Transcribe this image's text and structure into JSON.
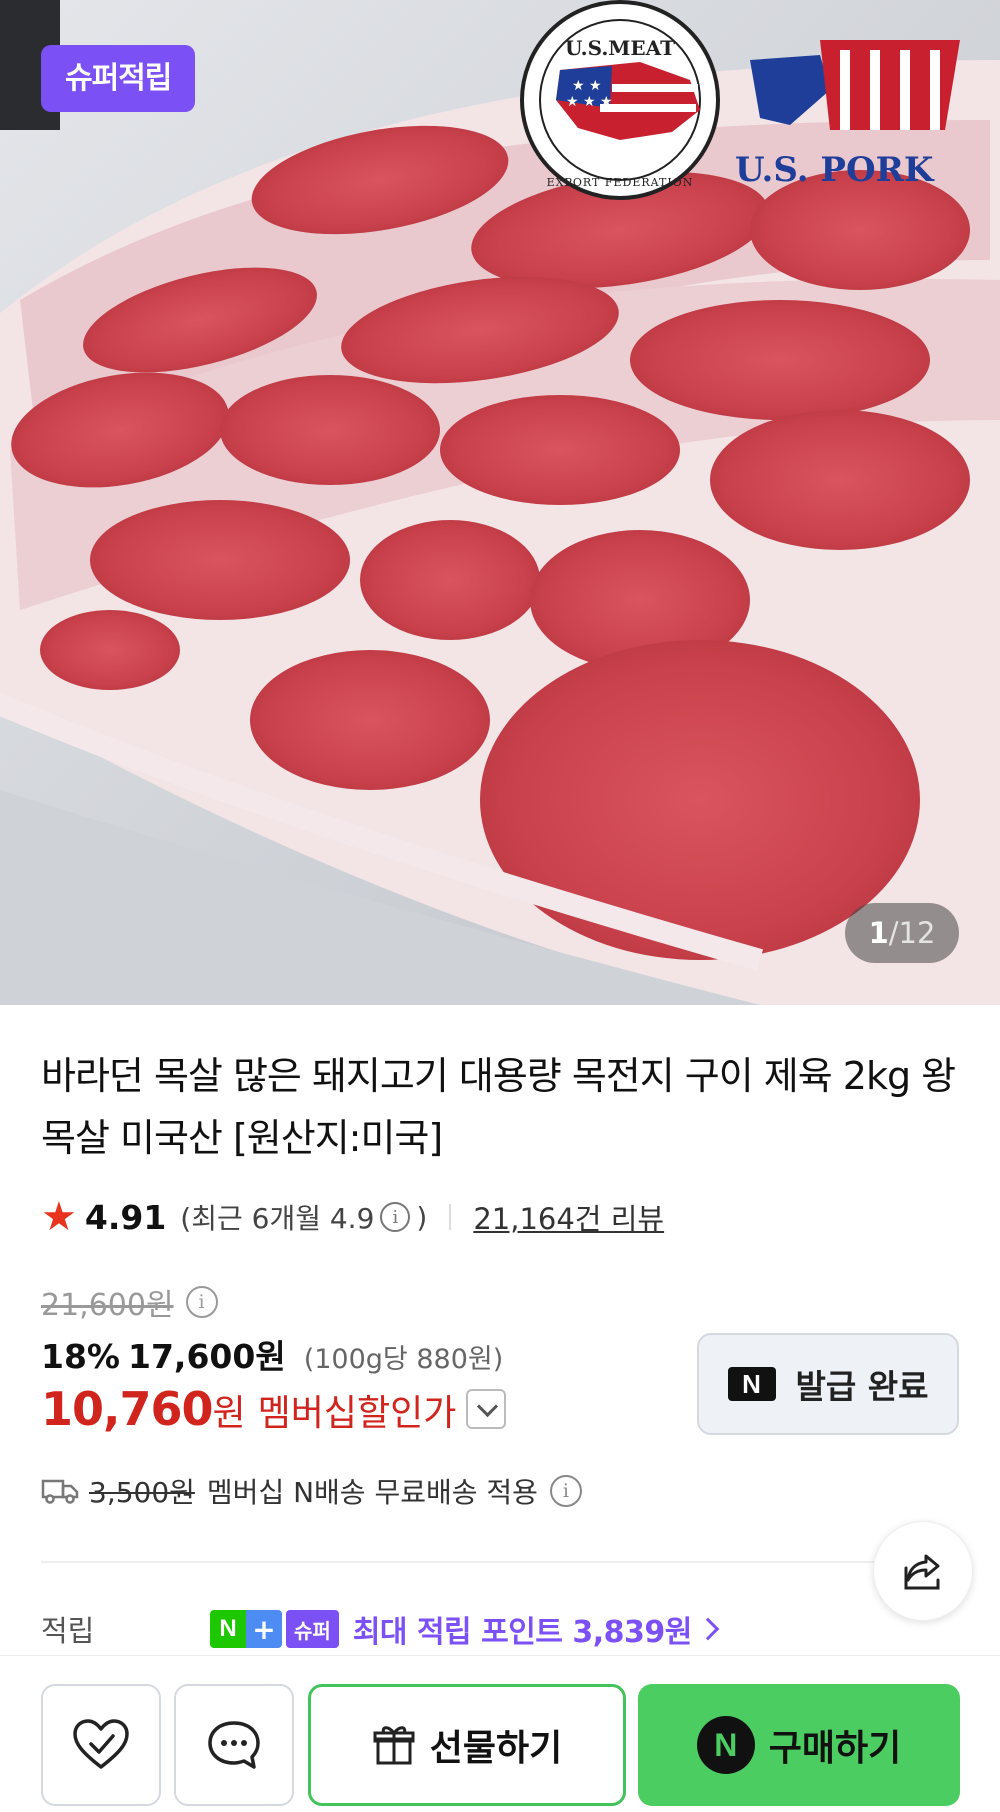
{
  "image": {
    "badge": "슈퍼적립",
    "counter_current": "1",
    "counter_separator": "/",
    "counter_total": "12",
    "logos": {
      "meat_federation_top": "U.S.MEAT",
      "meat_federation_bottom": "EXPORT FEDERATION",
      "pork_brand": "U.S. PORK"
    }
  },
  "product": {
    "title": "바라던 목살 많은 돼지고기 대용량 목전지 구이 제육 2kg 왕목살 미국산 [원산지:미국]"
  },
  "rating": {
    "score": "4.91",
    "recent_open": "(최근 6개월 4.9",
    "recent_close": ")",
    "reviews": "21,164건 리뷰"
  },
  "price": {
    "original": "21,600원",
    "discount_rate": "18%",
    "sale_price": "17,600원",
    "unit_price": "(100g당 880원)",
    "member_price": "10,760",
    "member_currency": "원",
    "member_label": "멤버십할인가"
  },
  "coupon": {
    "n_mark": "N",
    "label": "발급 완료"
  },
  "shipping": {
    "original_fee": "3,500원",
    "note": "멤버십 N배송 무료배송 적용"
  },
  "points": {
    "label": "적립",
    "tag_n": "N",
    "tag_plus": "+",
    "tag_super": "슈퍼",
    "text": "최대 적립 포인트 3,839원"
  },
  "bottom_bar": {
    "gift_label": "선물하기",
    "buy_n": "N",
    "buy_label": "구매하기"
  },
  "colors": {
    "accent_purple": "#7b50f5",
    "price_red": "#d0241d",
    "buy_green": "#4ccd62"
  }
}
